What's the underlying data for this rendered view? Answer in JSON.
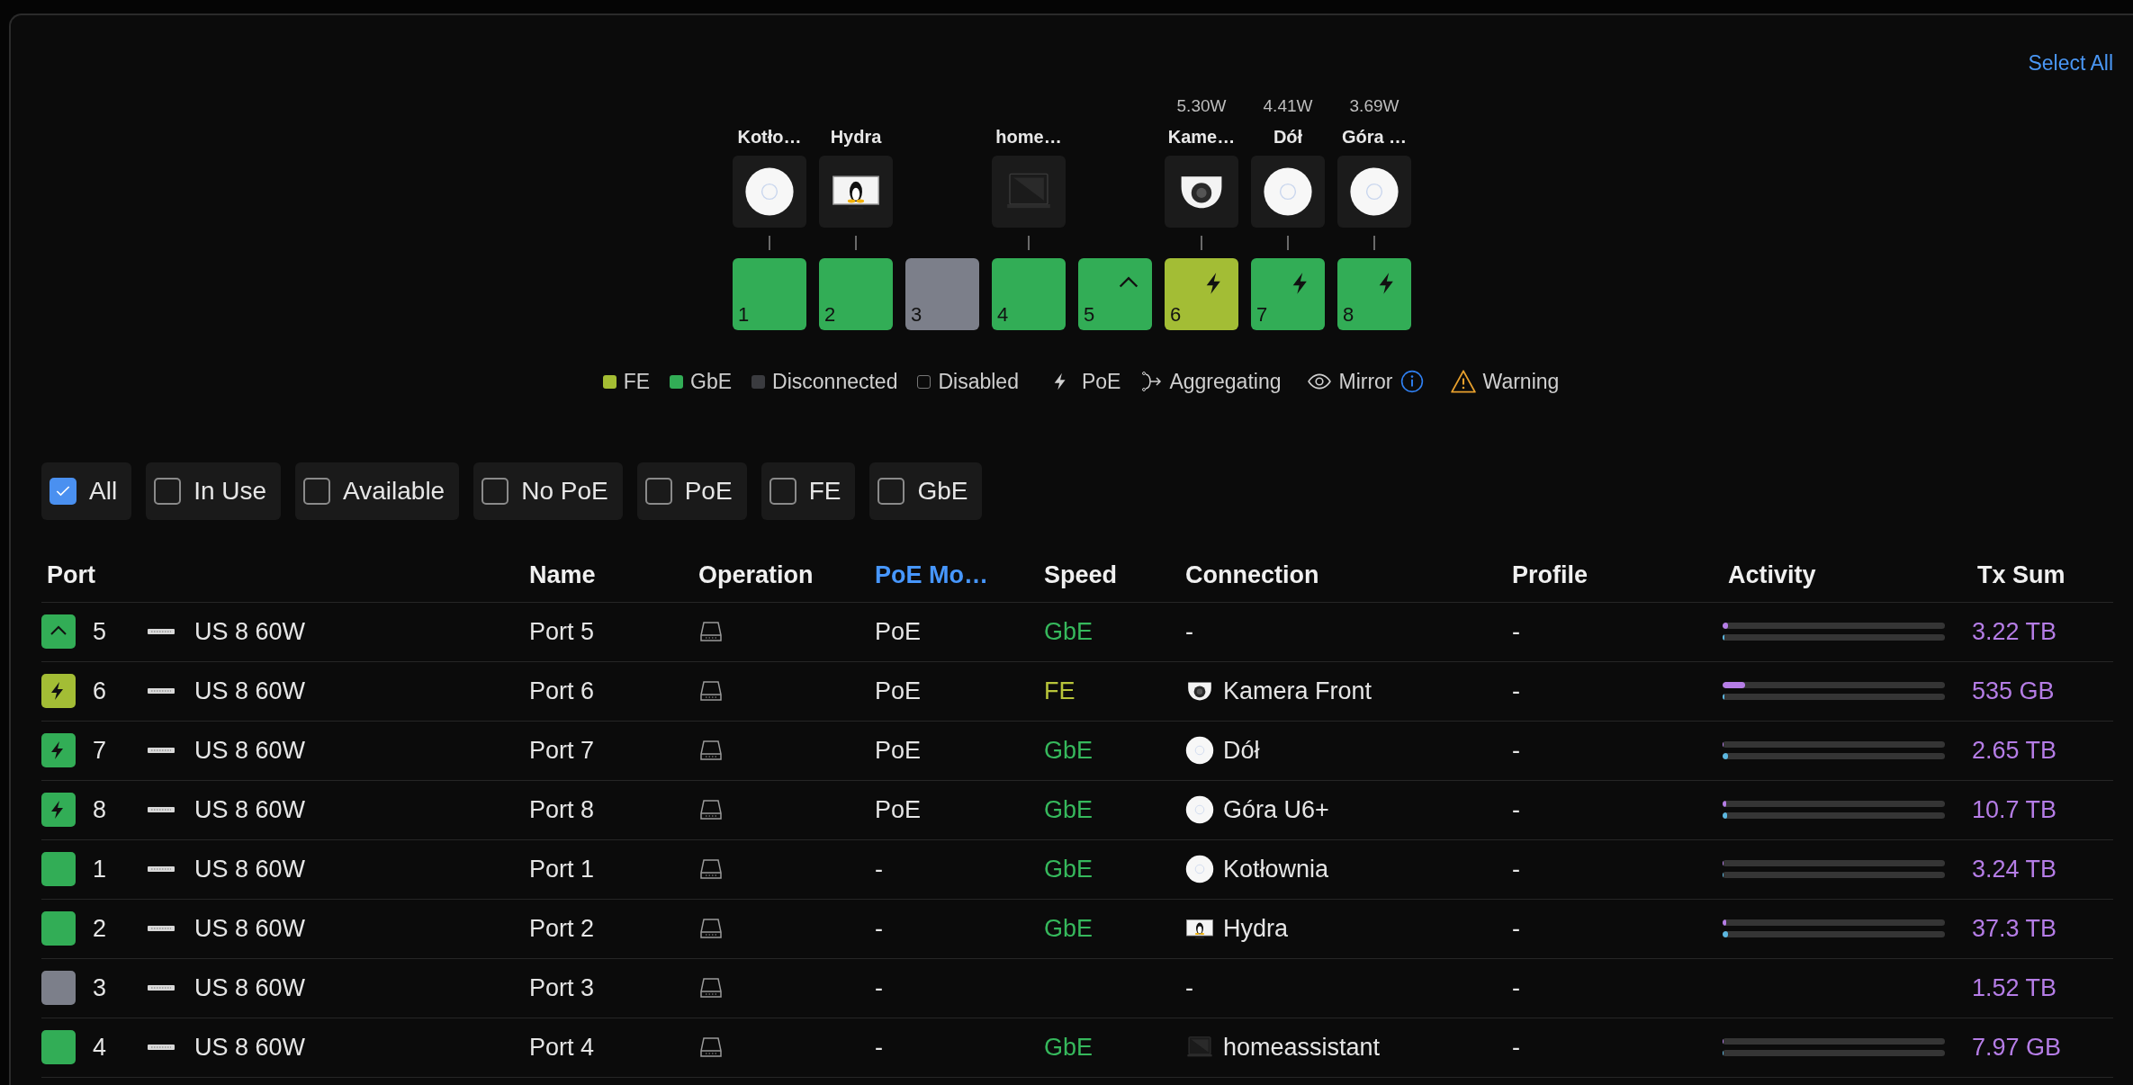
{
  "select_all": "Select All",
  "ports": [
    {
      "number": "1",
      "label": "Kotło…",
      "device": {
        "kind": "ap"
      },
      "color": "#32ad56",
      "kind": "plain"
    },
    {
      "number": "2",
      "label": "Hydra",
      "device": {
        "kind": "computer"
      },
      "color": "#32ad56",
      "kind": "plain"
    },
    {
      "number": "3",
      "color": "#7c7f8a",
      "kind": "plain"
    },
    {
      "number": "4",
      "label": "home…",
      "device": {
        "kind": "laptop"
      },
      "color": "#32ad56",
      "kind": "plain"
    },
    {
      "number": "5",
      "color": "#32ad56",
      "kind": "uplink"
    },
    {
      "number": "6",
      "power": "5.30W",
      "label": "Kame…",
      "device": {
        "kind": "camera"
      },
      "color": "#a3bd35",
      "kind": "poe"
    },
    {
      "number": "7",
      "power": "4.41W",
      "label": "Dół",
      "device": {
        "kind": "ap"
      },
      "color": "#32ad56",
      "kind": "poe"
    },
    {
      "number": "8",
      "power": "3.69W",
      "label": "Góra …",
      "device": {
        "kind": "ap"
      },
      "color": "#32ad56",
      "kind": "poe"
    }
  ],
  "legend": [
    {
      "label": "FE",
      "kind": "swatch",
      "color": "#a4bd33"
    },
    {
      "label": "GbE",
      "kind": "swatch",
      "color": "#32ad56"
    },
    {
      "label": "Disconnected",
      "kind": "swatch",
      "color": "#3a3b3f"
    },
    {
      "label": "Disabled",
      "kind": "outline"
    },
    {
      "label": "PoE",
      "kind": "poe"
    },
    {
      "label": "Aggregating",
      "kind": "aggregating"
    },
    {
      "label": "Mirror",
      "kind": "mirror"
    },
    {
      "label": "Warning",
      "kind": "warning"
    }
  ],
  "filters": [
    {
      "label": "All",
      "checked": true
    },
    {
      "label": "In Use",
      "checked": false
    },
    {
      "label": "Available",
      "checked": false
    },
    {
      "label": "No PoE",
      "checked": false
    },
    {
      "label": "PoE",
      "checked": false
    },
    {
      "label": "FE",
      "checked": false
    },
    {
      "label": "GbE",
      "checked": false
    }
  ],
  "table": {
    "columns": [
      {
        "label": "Port",
        "selected": false
      },
      {
        "label": "Name",
        "selected": false
      },
      {
        "label": "Operation",
        "selected": false
      },
      {
        "label": "PoE Mo…",
        "selected": true
      },
      {
        "label": "Speed",
        "selected": false
      },
      {
        "label": "Connection",
        "selected": false
      },
      {
        "label": "Profile",
        "selected": false
      },
      {
        "label": "Activity",
        "selected": false
      },
      {
        "label": "Tx Sum",
        "selected": false
      }
    ],
    "rows": [
      {
        "color": "#32ad56",
        "kind": "uplink",
        "port": "5",
        "switch": "US 8 60W",
        "name": "Port 5",
        "poe": "PoE",
        "speed": {
          "text": "GbE",
          "color": "#36b85c"
        },
        "connection": {
          "text": "-"
        },
        "profile": "-",
        "activity": [
          {
            "kind": "tx",
            "level": 0.025
          },
          {
            "kind": "rx",
            "level": 0.01
          }
        ],
        "tx_sum": "3.22 TB"
      },
      {
        "color": "#a3bd35",
        "kind": "poe",
        "port": "6",
        "switch": "US 8 60W",
        "name": "Port 6",
        "poe": "PoE",
        "speed": {
          "text": "FE",
          "color": "#b8c43a"
        },
        "connection": {
          "device": {
            "kind": "camera"
          },
          "text": "Kamera Front"
        },
        "profile": "-",
        "activity": [
          {
            "kind": "tx",
            "level": 0.1
          },
          {
            "kind": "rx",
            "level": 0.01
          }
        ],
        "tx_sum": "535 GB"
      },
      {
        "color": "#32ad56",
        "kind": "poe",
        "port": "7",
        "switch": "US 8 60W",
        "name": "Port 7",
        "poe": "PoE",
        "speed": {
          "text": "GbE",
          "color": "#36b85c"
        },
        "connection": {
          "device": {
            "kind": "ap"
          },
          "text": "Dół"
        },
        "profile": "-",
        "activity": [
          {
            "kind": "tx",
            "level": 0.006
          },
          {
            "kind": "rx",
            "level": 0.025
          }
        ],
        "tx_sum": "2.65 TB"
      },
      {
        "color": "#32ad56",
        "kind": "poe",
        "port": "8",
        "switch": "US 8 60W",
        "name": "Port 8",
        "poe": "PoE",
        "speed": {
          "text": "GbE",
          "color": "#36b85c"
        },
        "connection": {
          "device": {
            "kind": "ap"
          },
          "text": "Góra U6+"
        },
        "profile": "-",
        "activity": [
          {
            "kind": "tx",
            "level": 0.018
          },
          {
            "kind": "rx",
            "level": 0.02
          }
        ],
        "tx_sum": "10.7 TB"
      },
      {
        "color": "#32ad56",
        "kind": "plain",
        "port": "1",
        "switch": "US 8 60W",
        "name": "Port 1",
        "poe": "-",
        "speed": {
          "text": "GbE",
          "color": "#36b85c"
        },
        "connection": {
          "device": {
            "kind": "ap"
          },
          "text": "Kotłownia"
        },
        "profile": "-",
        "activity": [
          {
            "kind": "tx",
            "level": 0.006
          },
          {
            "kind": "rx",
            "level": 0.006
          }
        ],
        "tx_sum": "3.24 TB"
      },
      {
        "color": "#32ad56",
        "kind": "plain",
        "port": "2",
        "switch": "US 8 60W",
        "name": "Port 2",
        "poe": "-",
        "speed": {
          "text": "GbE",
          "color": "#36b85c"
        },
        "connection": {
          "device": {
            "kind": "computer"
          },
          "text": "Hydra"
        },
        "profile": "-",
        "activity": [
          {
            "kind": "tx",
            "level": 0.018
          },
          {
            "kind": "rx",
            "level": 0.025
          }
        ],
        "tx_sum": "37.3 TB"
      },
      {
        "color": "#7c7f8a",
        "kind": "plain",
        "port": "3",
        "switch": "US 8 60W",
        "name": "Port 3",
        "poe": "-",
        "connection": {
          "text": "-"
        },
        "profile": "-",
        "tx_sum": "1.52 TB"
      },
      {
        "color": "#32ad56",
        "kind": "plain",
        "port": "4",
        "switch": "US 8 60W",
        "name": "Port 4",
        "poe": "-",
        "speed": {
          "text": "GbE",
          "color": "#36b85c"
        },
        "connection": {
          "device": {
            "kind": "laptop"
          },
          "text": "homeassistant"
        },
        "profile": "-",
        "activity": [
          {
            "kind": "tx",
            "level": 0.006
          },
          {
            "kind": "rx",
            "level": 0.006
          }
        ],
        "tx_sum": "7.97 GB"
      }
    ]
  }
}
